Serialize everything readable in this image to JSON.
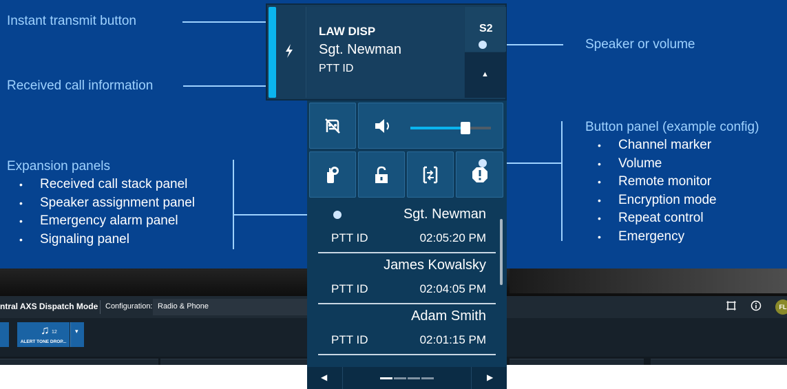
{
  "annotations": {
    "instant_transmit": "Instant transmit button",
    "received_call_info": "Received call information",
    "speaker_volume": "Speaker or volume",
    "button_panel_title": "Button panel (example config)",
    "button_panel_items": [
      "Channel marker",
      "Volume",
      "Remote monitor",
      "Encryption mode",
      "Repeat control",
      "Emergency"
    ],
    "expansion_title": "Expansion panels",
    "expansion_items": [
      "Received call stack panel",
      "Speaker assignment panel",
      "Emergency alarm panel",
      "Signaling panel"
    ]
  },
  "widget": {
    "channel_name": "LAW DISP",
    "caller": "Sgt. Newman",
    "caller_id": "PTT ID",
    "speaker": "S2",
    "accent_color": "#0bb4ee",
    "volume_level": 0.68,
    "icons": {
      "instant_transmit": "lightning-bolt-icon",
      "expand": "chevron-up-icon",
      "channel_marker": "channel-marker-icon",
      "volume": "speaker-icon",
      "remote_monitor": "remote-monitor-icon",
      "encryption": "unlocked-padlock-icon",
      "repeat": "repeat-control-icon",
      "emergency": "emergency-icon"
    },
    "calls": [
      {
        "name": "Sgt. Newman",
        "id": "PTT ID",
        "time": "02:05:20 PM"
      },
      {
        "name": "James Kowalsky",
        "id": "PTT ID",
        "time": "02:04:05 PM"
      },
      {
        "name": "Adam Smith",
        "id": "PTT ID",
        "time": "02:01:15 PM"
      }
    ],
    "page": {
      "current": 1,
      "total": 4
    }
  },
  "toolbar": {
    "mode_title": "ntral AXS Dispatch Mode",
    "config_label": "Configuration:",
    "config_value": "Radio & Phone",
    "avatar": "FL",
    "alert_button_label": "ALERT TONE DROP...",
    "alert_button_count": "12"
  }
}
